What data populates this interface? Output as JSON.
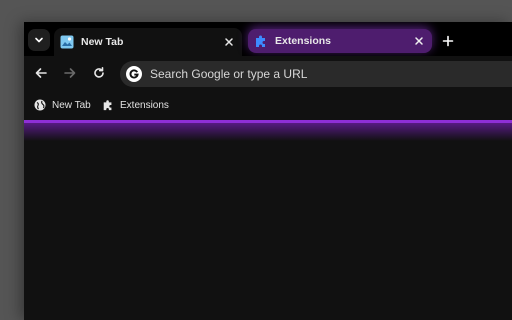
{
  "tabs": [
    {
      "label": "New Tab",
      "icon": "new-tab-favicon-icon",
      "active": true
    },
    {
      "label": "Extensions",
      "icon": "puzzle-icon",
      "active": false,
      "highlight_color": "#4e1d6e"
    }
  ],
  "toolbar": {
    "search_placeholder": "Search Google or type a URL"
  },
  "bookmarks": [
    {
      "label": "New Tab",
      "icon": "globe-icon"
    },
    {
      "label": "Extensions",
      "icon": "puzzle-icon"
    }
  ],
  "colors": {
    "accent": "#8e2fd6",
    "background": "#111111"
  }
}
